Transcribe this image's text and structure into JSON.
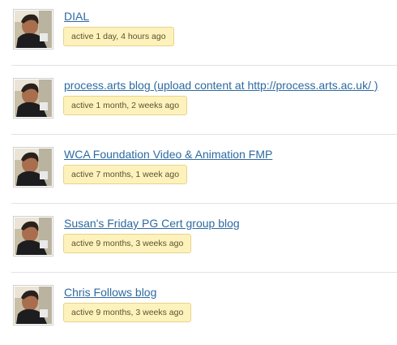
{
  "groups": [
    {
      "title": "DIAL",
      "activity": "active 1 day, 4 hours ago",
      "avatar_icon": "user-photo-icon"
    },
    {
      "title": "process.arts blog (upload content at http://process.arts.ac.uk/ )",
      "activity": "active 1 month, 2 weeks ago",
      "avatar_icon": "user-photo-icon"
    },
    {
      "title": "WCA Foundation Video & Animation FMP",
      "activity": "active 7 months, 1 week ago",
      "avatar_icon": "user-photo-icon"
    },
    {
      "title": "Susan's Friday PG Cert group blog",
      "activity": "active 9 months, 3 weeks ago",
      "avatar_icon": "user-photo-icon"
    },
    {
      "title": "Chris Follows blog",
      "activity": "active 9 months, 3 weeks ago",
      "avatar_icon": "user-photo-icon"
    }
  ],
  "colors": {
    "link": "#2e6aa1",
    "badge_background": "#fdf2bc",
    "badge_border": "#e7d288",
    "divider": "#e3e3e3"
  }
}
